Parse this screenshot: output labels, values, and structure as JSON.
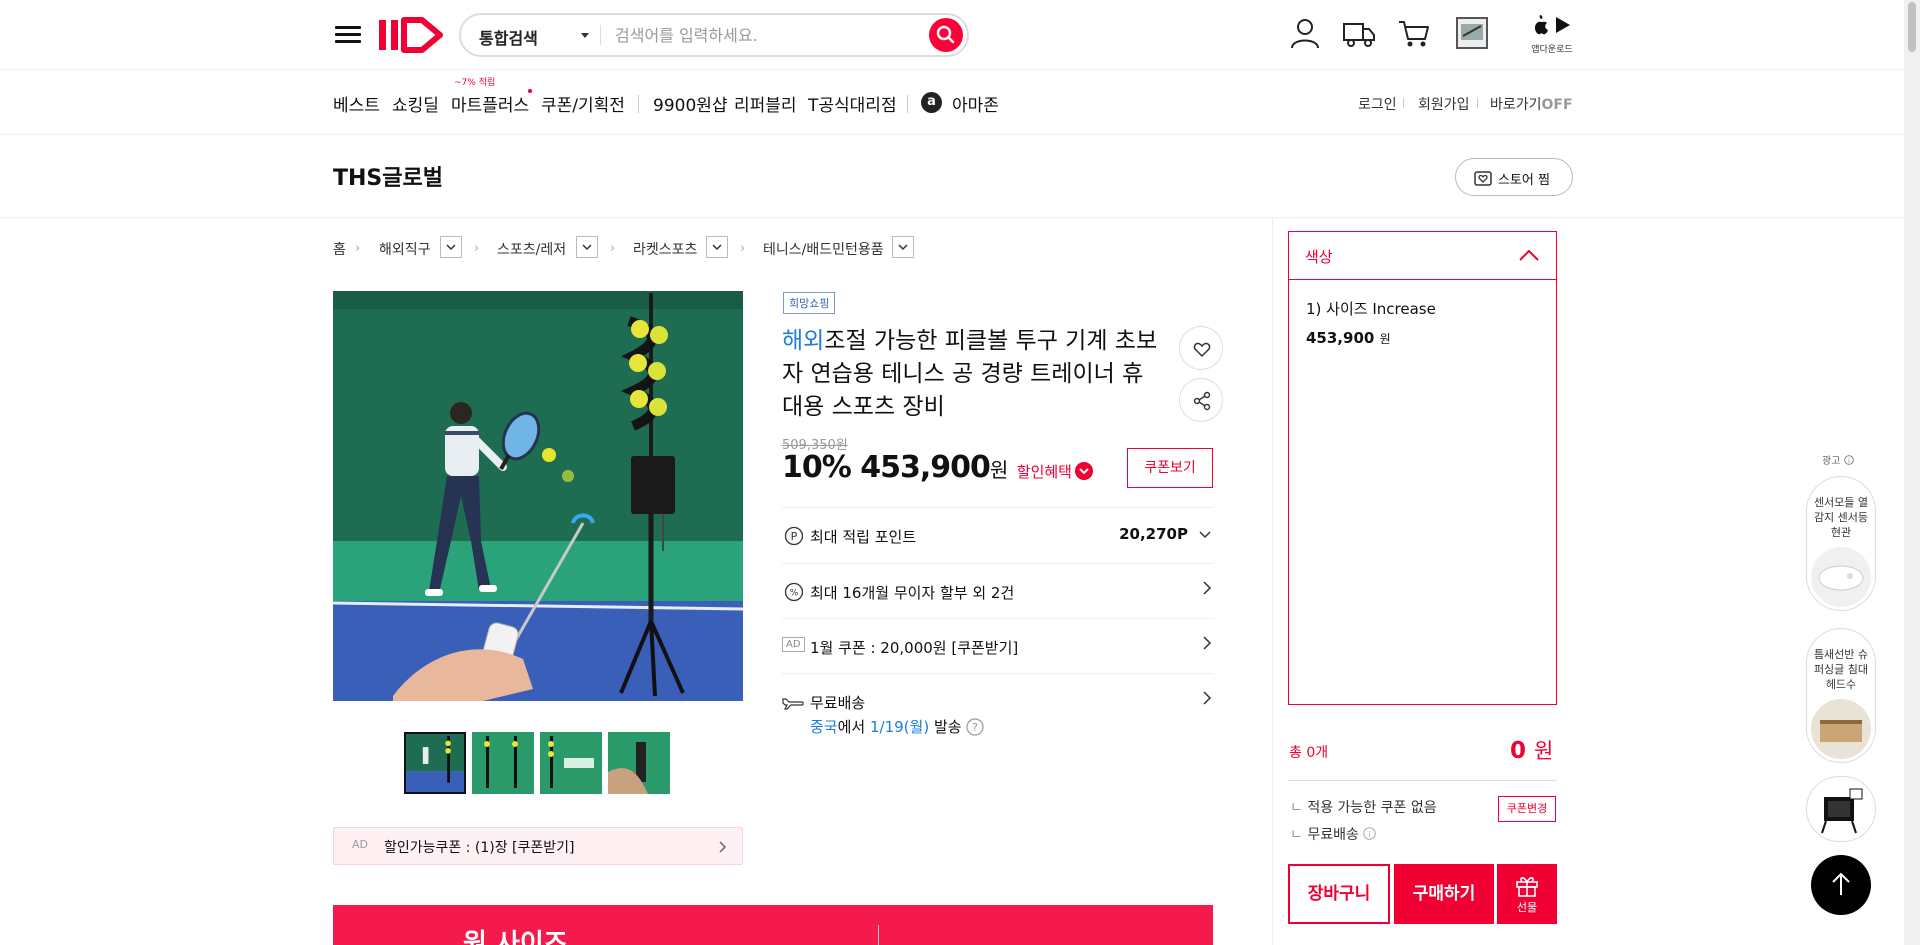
{
  "header": {
    "search_scope": "통합검색",
    "search_placeholder": "검색어를 입력하세요.",
    "app_download": "앱다운로드"
  },
  "gnb": {
    "items": [
      "베스트",
      "쇼킹딜",
      "마트플러스",
      "쿠폰/기획전",
      "9900원샵",
      "리퍼블리",
      "T공식대리점",
      "아마존"
    ],
    "mart_badge": "~7% 적립",
    "util": [
      "로그인",
      "회원가입",
      "바로가기",
      "OFF"
    ]
  },
  "store": {
    "name": "THS글로벌",
    "like_label": "스토어 찜"
  },
  "breadcrumb": [
    "홈",
    "해외직구",
    "스포츠/레저",
    "라켓스포츠",
    "테니스/배드민턴용품"
  ],
  "product": {
    "badge": "희망쇼핑",
    "overseas_tag": "해외",
    "title": "조절 가능한 피클볼 투구 기계 초보자 연습용 테니스 공 경량 트레이너 휴대용 스포츠 장비",
    "original_price": "509,350원",
    "discount_rate": "10%",
    "price": "453,900",
    "won": "원",
    "benefit_label": "할인혜택",
    "coupon_view": "쿠폰보기",
    "points_label": "최대 적립 포인트",
    "points_value": "20,270P",
    "installment": "최대 16개월 무이자 할부 외 2건",
    "ad_tag": "AD",
    "jan_coupon": "1월 쿠폰 : 20,000원 [쿠폰받기]",
    "shipping_label": "무료배송",
    "ship_origin": "중국",
    "ship_mid": "에서",
    "ship_date": "1/19(월)",
    "ship_suffix": "발송",
    "coupon_bar": "할인가능쿠폰 : (1)장 [쿠폰받기]",
    "coupon_bar_count": "1"
  },
  "order_panel": {
    "option_title": "색상",
    "option_item": "1) 사이즈 Increase",
    "option_price": "453,900",
    "option_won": "원",
    "total_label": "총 0개",
    "total_amount": "0",
    "total_won": "원",
    "no_coupon": "적용 가능한 쿠폰 없음",
    "coupon_change": "쿠폰변경",
    "free_ship": "무료배송",
    "cart": "장바구니",
    "buy": "구매하기",
    "gift": "선물"
  },
  "ads": {
    "label": "광고",
    "card1": "센서모들 열감지 센서등 현관",
    "card2": "틈새선반 슈퍼싱글 침대헤드수"
  },
  "promo": {
    "text": "원 사이즈"
  },
  "colors": {
    "brand": "#f00033",
    "blue": "#1c7ce1"
  }
}
